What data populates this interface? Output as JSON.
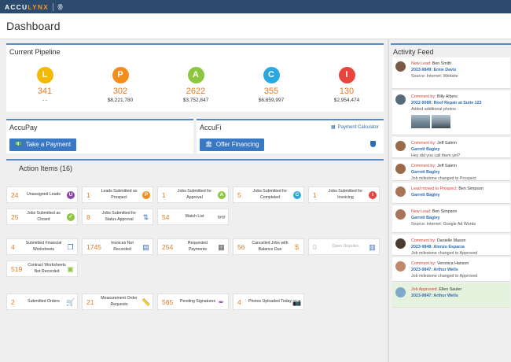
{
  "app": {
    "logo_main": "ACCU",
    "logo_accent": "LYNX"
  },
  "page": {
    "title": "Dashboard"
  },
  "pipeline": {
    "title": "Current Pipeline",
    "items": [
      {
        "letter": "L",
        "count": "341",
        "amount": "- -",
        "color": "#f5b800"
      },
      {
        "letter": "P",
        "count": "302",
        "amount": "$8,221,780",
        "color": "#f28c1b"
      },
      {
        "letter": "A",
        "count": "2622",
        "amount": "$3,752,847",
        "color": "#8cc63f"
      },
      {
        "letter": "C",
        "count": "355",
        "amount": "$6,859,997",
        "color": "#29a9e0"
      },
      {
        "letter": "I",
        "count": "130",
        "amount": "$2,954,474",
        "color": "#e8453c"
      }
    ]
  },
  "accupay": {
    "title": "AccuPay",
    "button": "Take a Payment"
  },
  "accufi": {
    "title": "AccuFi",
    "button": "Offer Financing",
    "calc_link": "Payment Calculator"
  },
  "actions": {
    "title": "Action Items (16)",
    "rows": [
      [
        {
          "count": "24",
          "label": "Unassigned Leads",
          "icon": "letter-u-icon",
          "letter": "U",
          "color": "#8e44ad"
        },
        {
          "count": "1",
          "label": "Leads Submitted as Prospect",
          "icon": "letter-p-icon",
          "letter": "P",
          "color": "#f28c1b"
        },
        {
          "count": "1",
          "label": "Jobs Submitted for Approval",
          "icon": "letter-a-icon",
          "letter": "A",
          "color": "#8cc63f"
        },
        {
          "count": "5",
          "label": "Jobs Submitted for Completed",
          "icon": "letter-c-icon",
          "letter": "C",
          "color": "#29a9e0"
        },
        {
          "count": "1",
          "label": "Jobs Submitted for Invoicing",
          "icon": "letter-i-icon",
          "letter": "I",
          "color": "#e8453c"
        }
      ],
      [
        {
          "count": "25",
          "label": "Jobs Submitted as Closed",
          "icon": "check-circle-icon",
          "letter": "✓",
          "color": "#8cc63f"
        },
        {
          "count": "8",
          "label": "Jobs Submitted for Status Approval",
          "icon": "swap-arrows-icon",
          "glyph": "⇅",
          "color": "#2f6db3"
        },
        {
          "count": "54",
          "label": "Watch List",
          "icon": "binoculars-icon",
          "glyph": "👓",
          "color": "#8e44ad"
        }
      ],
      [
        {
          "count": "4",
          "label": "Submitted Financial Worksheets",
          "icon": "documents-icon",
          "glyph": "❐",
          "color": "#2f6db3"
        },
        {
          "count": "1745",
          "label": "Invoices Not Recorded",
          "icon": "document-icon",
          "glyph": "▤",
          "color": "#2f6db3"
        },
        {
          "count": "254",
          "label": "Requested Payments",
          "icon": "payments-icon",
          "glyph": "▦",
          "color": "#555555"
        },
        {
          "count": "56",
          "label": "Cancelled Jobs with Balance Due",
          "icon": "dollar-icon",
          "glyph": "$",
          "color": "#f28c1b"
        },
        {
          "count": "0",
          "label": "Open Disputes",
          "icon": "dispute-document-icon",
          "glyph": "▥",
          "color": "#2f6db3",
          "muted": true
        }
      ],
      [
        {
          "count": "519",
          "label": "Contract Worksheets Not Recorded",
          "icon": "contract-check-icon",
          "glyph": "▣",
          "color": "#8cc63f"
        }
      ],
      [
        {
          "count": "2",
          "label": "Submitted Orders",
          "icon": "cart-icon",
          "glyph": "🛒",
          "color": "#f28c1b"
        },
        {
          "count": "21",
          "label": "Measurement Order Requests",
          "icon": "ruler-icon",
          "glyph": "📏",
          "color": "#f28c1b"
        },
        {
          "count": "565",
          "label": "Pending Signatures",
          "icon": "pen-icon",
          "glyph": "✒",
          "color": "#8e44ad"
        },
        {
          "count": "4",
          "label": "Photos Uploaded Today",
          "icon": "camera-icon",
          "glyph": "📷",
          "color": "#f28c1b"
        }
      ]
    ]
  },
  "feed": {
    "title": "Activity Feed",
    "entries": [
      {
        "type": "New Lead:",
        "person": "Ben Smith",
        "link": "2023-9849: Ernie Davis",
        "desc": "Source: Internet: Website",
        "avatar": "#7a5a44"
      },
      {
        "type": "Comment by:",
        "person": "Billy Albers",
        "link": "2022-9089: Roof Repair at Suite 123",
        "desc": "Added additional photos",
        "avatar": "#556b7a",
        "photos": true
      },
      {
        "type": "Comment by:",
        "person": "Jeff Salem",
        "link": "Garrett Bagley",
        "desc": "Hey did you call them yet?",
        "avatar": "#9b6a4a"
      },
      {
        "type": "Comment by:",
        "person": "Jeff Salem",
        "link": "Garrett Bagley",
        "desc": "Job milestone changed to Prospect",
        "avatar": "#9b6a4a"
      },
      {
        "type": "Lead moved to Prospect:",
        "person": "Ben Simpson",
        "link": "Garrett Bagley",
        "desc": "",
        "avatar": "#a8745a"
      },
      {
        "type": "New Lead:",
        "person": "Ben Simpson",
        "link": "Garrett Bagley",
        "desc": "Source: Internet: Google Ad Words",
        "avatar": "#a8745a"
      },
      {
        "type": "Comment by:",
        "person": "Danielle Mason",
        "link": "2023-9848: Alonzo Esparza",
        "desc": "Job milestone changed to Approved",
        "avatar": "#4a3a34"
      },
      {
        "type": "Comment by:",
        "person": "Veronica Hanson",
        "link": "2023-9847: Arthur Wells",
        "desc": "Job milestone changed to Approved",
        "avatar": "#c08a6a"
      },
      {
        "type": "Job Approved:",
        "person": "Ellen Sauter",
        "link": "2023-9847: Arthur Wells",
        "desc": "",
        "avatar": "#7fa9cc",
        "highlight": true
      }
    ]
  }
}
